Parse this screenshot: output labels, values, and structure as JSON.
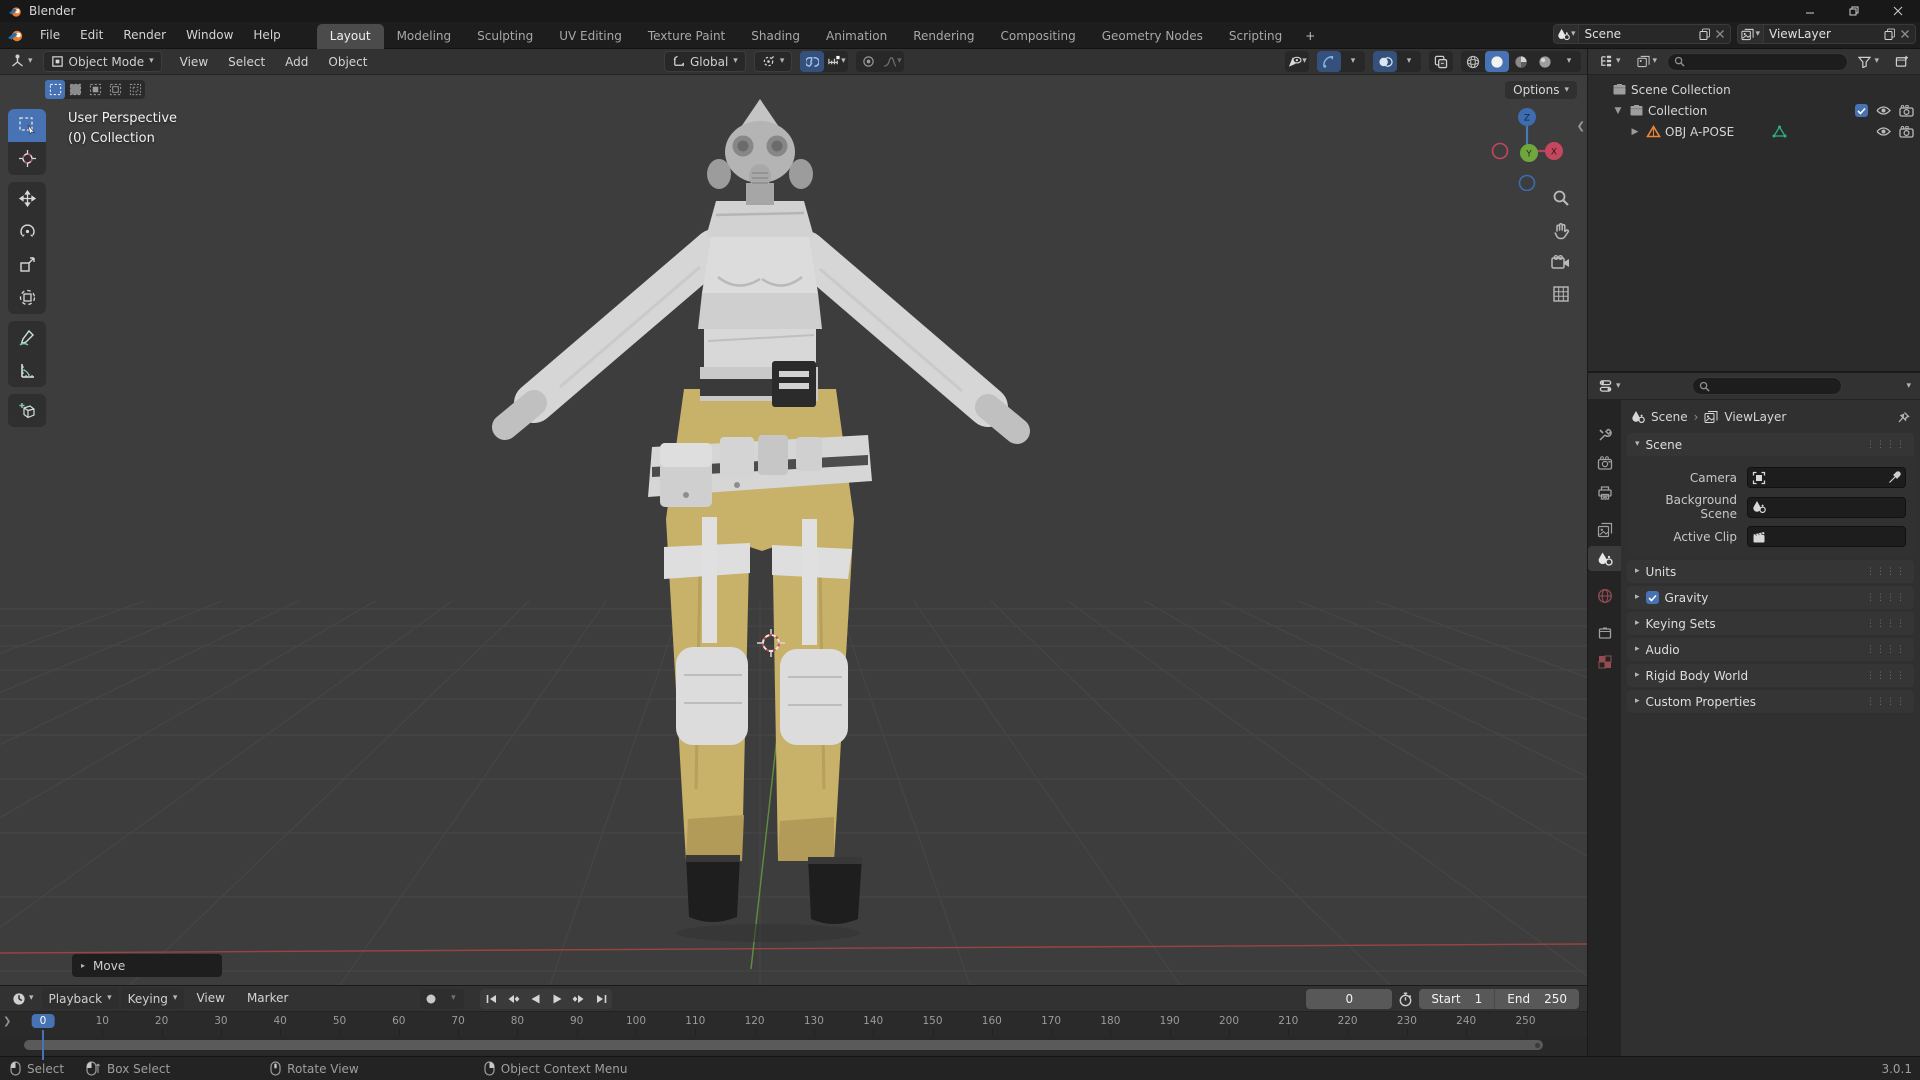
{
  "window": {
    "title": "Blender"
  },
  "topbar": {
    "menus": [
      "File",
      "Edit",
      "Render",
      "Window",
      "Help"
    ],
    "workspaces": [
      {
        "label": "Layout",
        "active": true
      },
      {
        "label": "Modeling",
        "active": false
      },
      {
        "label": "Sculpting",
        "active": false
      },
      {
        "label": "UV Editing",
        "active": false
      },
      {
        "label": "Texture Paint",
        "active": false
      },
      {
        "label": "Shading",
        "active": false
      },
      {
        "label": "Animation",
        "active": false
      },
      {
        "label": "Rendering",
        "active": false
      },
      {
        "label": "Compositing",
        "active": false
      },
      {
        "label": "Geometry Nodes",
        "active": false
      },
      {
        "label": "Scripting",
        "active": false
      }
    ],
    "new_workspace": "+",
    "scene_name": "Scene",
    "view_layer_name": "ViewLayer"
  },
  "viewport": {
    "mode": "Object Mode",
    "menus": [
      "View",
      "Select",
      "Add",
      "Object"
    ],
    "orientation": "Global",
    "options_label": "Options",
    "overlay_line1": "User Perspective",
    "overlay_line2": "(0) Collection",
    "operator_label": "Move",
    "tools": [
      "select-box",
      "cursor",
      "move",
      "rotate",
      "scale",
      "transform",
      "annotate",
      "measure",
      "add-cube"
    ],
    "gizmo_axes": {
      "x": "X",
      "y": "Y",
      "z": "Z"
    }
  },
  "outliner": {
    "rows": [
      {
        "label": "Scene Collection",
        "icon": "collection",
        "indent": 0,
        "caret": "",
        "datainfo": "",
        "toggles": []
      },
      {
        "label": "Collection",
        "icon": "collection",
        "indent": 1,
        "caret": "down",
        "datainfo": "",
        "toggles": [
          "checkbox",
          "eye",
          "camera"
        ]
      },
      {
        "label": "OBJ A-POSE",
        "icon": "mesh",
        "indent": 2,
        "caret": "right",
        "datainfo": "meshdata",
        "toggles": [
          "eye",
          "camera"
        ]
      }
    ]
  },
  "properties": {
    "breadcrumb_scene": "Scene",
    "breadcrumb_layer": "ViewLayer",
    "tabs": [
      "tool",
      "render",
      "output",
      "viewlayer",
      "scene",
      "world",
      "object",
      "texture"
    ],
    "active_tab": "scene",
    "scene_panel": {
      "title": "Scene",
      "fields": [
        {
          "label": "Camera",
          "icon": "camera-data",
          "eyedropper": true
        },
        {
          "label": "Background Scene",
          "icon": "scene",
          "eyedropper": false
        },
        {
          "label": "Active Clip",
          "icon": "clip",
          "eyedropper": false
        }
      ]
    },
    "panels": [
      {
        "title": "Units",
        "checked": false
      },
      {
        "title": "Gravity",
        "checked": true
      },
      {
        "title": "Keying Sets",
        "checked": false
      },
      {
        "title": "Audio",
        "checked": false
      },
      {
        "title": "Rigid Body World",
        "checked": false
      },
      {
        "title": "Custom Properties",
        "checked": false
      }
    ]
  },
  "timeline": {
    "menus": [
      {
        "label": "Playback",
        "dropdown": true
      },
      {
        "label": "Keying",
        "dropdown": true
      },
      {
        "label": "View",
        "dropdown": false
      },
      {
        "label": "Marker",
        "dropdown": false
      }
    ],
    "transport": [
      "jump-start",
      "prev-keyframe",
      "play-reverse",
      "play",
      "next-keyframe",
      "jump-end"
    ],
    "current_frame": "0",
    "start_label": "Start",
    "start_value": "1",
    "end_label": "End",
    "end_value": "250",
    "ticks": [
      0,
      10,
      20,
      30,
      40,
      50,
      60,
      70,
      80,
      90,
      100,
      110,
      120,
      130,
      140,
      150,
      160,
      170,
      180,
      190,
      200,
      210,
      220,
      230,
      240,
      250
    ],
    "playhead_frame": "0"
  },
  "statusbar": {
    "items": [
      {
        "icon": "mouse-left",
        "label": "Select"
      },
      {
        "icon": "mouse-drag",
        "label": "Box Select"
      },
      {
        "icon": "mouse-middle",
        "label": "Rotate View"
      },
      {
        "icon": "mouse-right",
        "label": "Object Context Menu"
      }
    ],
    "version": "3.0.1"
  },
  "colors": {
    "accent": "#4772b3",
    "object_orange": "#e8863a",
    "mesh_green": "#2eb089",
    "axis_x": "#b0484f",
    "axis_y": "#6a9d3e",
    "axis_z": "#3d6cb0",
    "viewport_bg": "#3d3d3d"
  }
}
